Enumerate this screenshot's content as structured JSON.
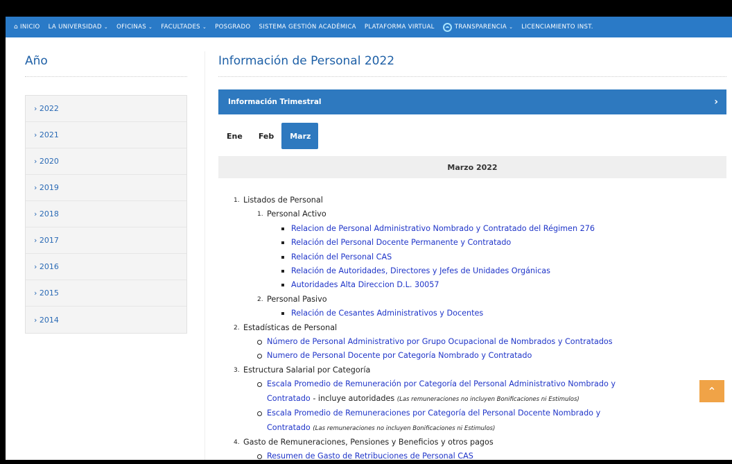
{
  "nav": {
    "items": [
      {
        "label": "INICIO",
        "icon": "home-icon"
      },
      {
        "label": "LA UNIVERSIDAD",
        "chevron": true
      },
      {
        "label": "OFICINAS",
        "chevron": true
      },
      {
        "label": "FACULTADES",
        "chevron": true
      },
      {
        "label": "POSGRADO"
      },
      {
        "label": "SISTEMA GESTIÓN ACADÉMICA"
      },
      {
        "label": "PLATAFORMA VIRTUAL"
      },
      {
        "label": "TRANSPARENCIA",
        "chevron": true,
        "icon": "transparency-icon"
      },
      {
        "label": "LICENCIAMIENTO INST."
      }
    ]
  },
  "sidebar": {
    "title": "Año",
    "years": [
      "› 2022",
      "› 2021",
      "› 2020",
      "› 2019",
      "› 2018",
      "› 2017",
      "› 2016",
      "› 2015",
      "› 2014"
    ]
  },
  "main": {
    "title": "Información de Personal 2022",
    "trimestral_label": "Información Trimestral",
    "tabs": [
      "Ene",
      "Feb",
      "Marz"
    ],
    "active_tab": "Marz",
    "month_heading": "Marzo 2022"
  },
  "doc": {
    "s1": {
      "num": "1.",
      "title": "Listados de Personal"
    },
    "s1a": {
      "num": "1.",
      "title": "Personal Activo"
    },
    "s1a_links": [
      "Relacion de Personal Administrativo Nombrado y Contratado del Régimen 276",
      "Relación del Personal Docente Permanente y Contratado",
      "Relación del Personal CAS",
      "Relación de Autoridades, Directores y Jefes de Unidades Orgánicas",
      "Autoridades Alta Direccion D.L. 30057"
    ],
    "s1b": {
      "num": "2.",
      "title": "Personal Pasivo"
    },
    "s1b_links": [
      "Relación de Cesantes Administrativos y Docentes"
    ],
    "s2": {
      "num": "2.",
      "title": "Estadísticas de Personal"
    },
    "s2_links": [
      "Número de Personal Administrativo por Grupo Ocupacional de Nombrados y Contratados",
      "Numero de Personal Docente por Categoría Nombrado y Contratado"
    ],
    "s3": {
      "num": "3.",
      "title": "Estructura Salarial por Categoría"
    },
    "s3_item1": {
      "link_line1": "Escala Promedio de Remuneración por Categoría del Personal Administrativo Nombrado y",
      "link_line2": "Contratado",
      "suffix": " - incluye autoridades ",
      "note": "(Las remuneraciones no incluyen Bonificaciones ni Estimulos)"
    },
    "s3_item2": {
      "link_line1": "Escala Promedio de Remuneraciones por Categoría del Personal Docente Nombrado y",
      "link_line2": "Contratado",
      "note": "(Las remuneraciones no incluyen Bonificaciones ni Estimulos)"
    },
    "s4": {
      "num": "4.",
      "title": "Gasto de Remuneraciones, Pensiones y Beneficios y otros pagos"
    },
    "s4_links": [
      "Resumen de Gasto de Retribuciones de Personal CAS"
    ]
  },
  "colors": {
    "nav": "#2a7ac7",
    "accent": "#2e79bf",
    "link": "#1f35c8",
    "scroll_top": "#f0a347"
  }
}
